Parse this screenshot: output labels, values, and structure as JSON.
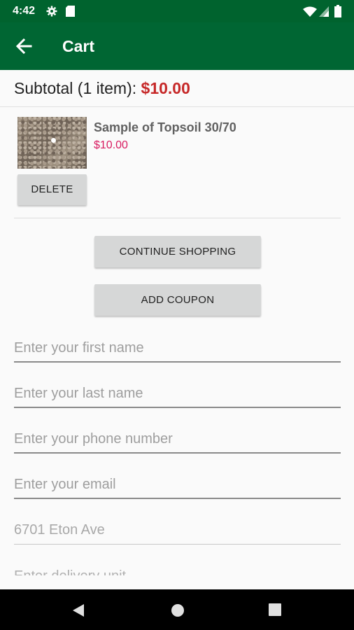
{
  "status_bar": {
    "time": "4:42",
    "left_icons": [
      "settings-icon",
      "sd-card-icon"
    ],
    "right_icons": [
      "wifi-icon",
      "signal-icon",
      "battery-icon"
    ]
  },
  "app_bar": {
    "title": "Cart",
    "background": "#006633"
  },
  "cart": {
    "subtotal_label": "Subtotal (1 item): ",
    "subtotal_amount": "$10.00",
    "items": [
      {
        "name": "Sample of Topsoil 30/70",
        "price": "$10.00",
        "delete_label": "DELETE"
      }
    ]
  },
  "actions": {
    "continue_label": "CONTINUE SHOPPING",
    "coupon_label": "ADD COUPON"
  },
  "form": {
    "first_name_placeholder": "Enter your first name",
    "last_name_placeholder": "Enter your last name",
    "phone_placeholder": "Enter your phone number",
    "email_placeholder": "Enter your email",
    "address_value": "6701 Eton Ave",
    "delivery_placeholder": "Enter delivery unit"
  },
  "nav_bar": {
    "buttons": [
      "back-nav-icon",
      "home-nav-icon",
      "recents-nav-icon"
    ]
  },
  "colors": {
    "accent": "#006633",
    "price_red": "#c62828",
    "item_price": "#d81b60"
  }
}
